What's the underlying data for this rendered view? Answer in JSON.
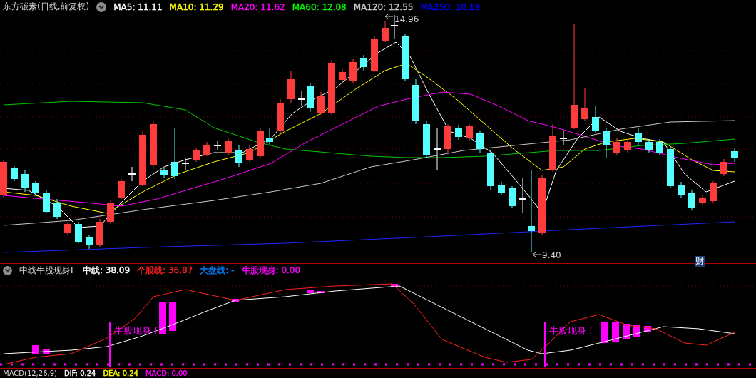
{
  "header": {
    "title": "东方碳素(日线,前复权)",
    "indicators": [
      {
        "text": "MA5: 11.11",
        "color": "#ffffff"
      },
      {
        "text": "MA10: 11.29",
        "color": "#ffff00"
      },
      {
        "text": "MA20: 11.62",
        "color": "#ff00ff"
      },
      {
        "text": "MA60: 12.08",
        "color": "#00ff00"
      },
      {
        "text": "MA120: 12.55",
        "color": "#c8c8c8"
      },
      {
        "text": "MA250: 10.18",
        "color": "#0000ff"
      }
    ]
  },
  "chart_labels": {
    "high": "14.96",
    "low": "9.40",
    "badge": "财"
  },
  "sub_header": {
    "title": "中线牛股现身F",
    "indicators": [
      {
        "text": "中线: 38.09",
        "color": "#ffffff"
      },
      {
        "text": "个股线: 36.87",
        "color": "#ff2020"
      },
      {
        "text": "大盘线: -",
        "color": "#0080ff"
      },
      {
        "text": "牛股现身: 0.00",
        "color": "#ff00ff"
      }
    ]
  },
  "signals": [
    "牛股现身！",
    "牛股现身！"
  ],
  "footer": {
    "title": "MACD(12,26,9)",
    "indicators": [
      {
        "text": "DIF: 0.24",
        "color": "#ffffff"
      },
      {
        "text": "DEA: 0.24",
        "color": "#ffff00"
      },
      {
        "text": "MACD: 0.00",
        "color": "#ff00ff"
      }
    ]
  }
}
